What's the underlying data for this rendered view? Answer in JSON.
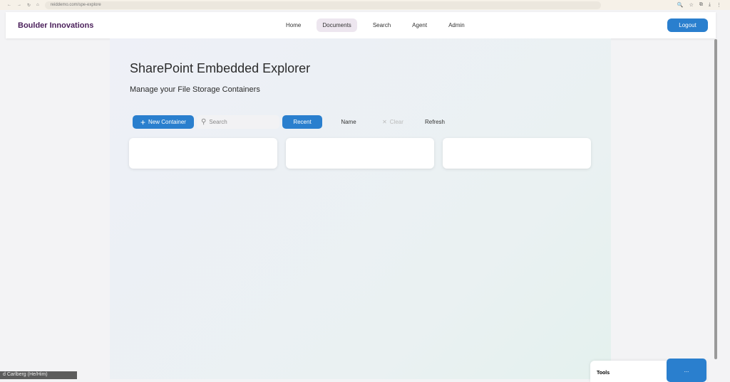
{
  "browser": {
    "url": "reiddemo.com/spe-explore"
  },
  "header": {
    "brand": "Boulder Innovations",
    "nav": [
      "Home",
      "Documents",
      "Search",
      "Agent",
      "Admin"
    ],
    "logout": "Logout"
  },
  "main": {
    "title": "SharePoint Embedded Explorer",
    "subtitle": "Manage your File Storage Containers",
    "toolbar": {
      "new_container": "New Container",
      "search_placeholder": "Search",
      "recent": "Recent",
      "name": "Name",
      "clear": "Clear",
      "refresh": "Refresh"
    }
  },
  "tools": {
    "label": "Tools",
    "button": "..."
  },
  "caption": "d Carlberg (He/Him)"
}
